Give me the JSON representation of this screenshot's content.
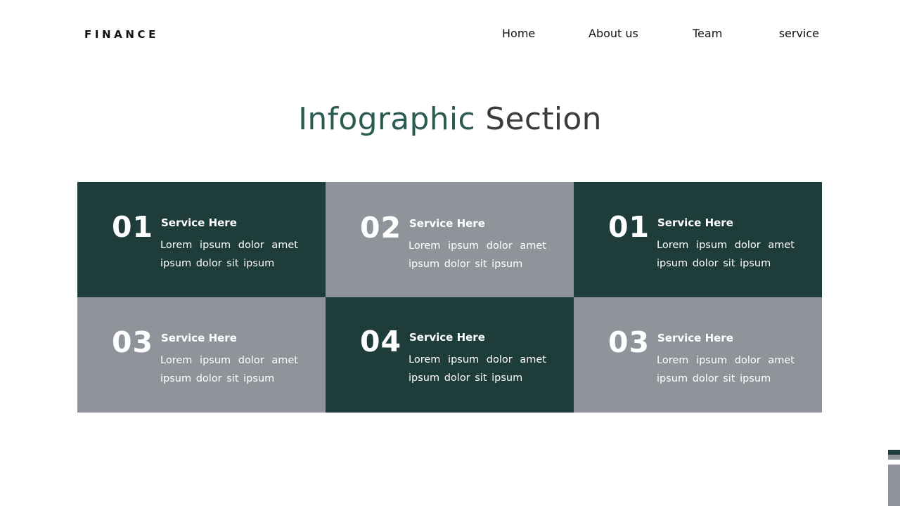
{
  "brand": {
    "name": "FINANCE"
  },
  "nav": {
    "items": [
      {
        "label": "Home"
      },
      {
        "label": "About us"
      },
      {
        "label": "Team"
      },
      {
        "label": "service"
      }
    ]
  },
  "section": {
    "title_accent": "Infographic",
    "title_rest": "Section"
  },
  "colors": {
    "dark_green": "#1e3d3a",
    "gray": "#8f949b",
    "accent_text": "#2a5c52"
  },
  "services": [
    {
      "number": "01",
      "title": "Service Here",
      "description": "Lorem ipsum dolor amet ipsum dolor sit ipsum"
    },
    {
      "number": "02",
      "title": "Service Here",
      "description": "Lorem ipsum dolor amet ipsum dolor sit ipsum"
    },
    {
      "number": "01",
      "title": "Service Here",
      "description": "Lorem ipsum dolor amet ipsum dolor sit ipsum"
    },
    {
      "number": "03",
      "title": "Service Here",
      "description": "Lorem ipsum dolor amet ipsum dolor sit ipsum"
    },
    {
      "number": "04",
      "title": "Service Here",
      "description": "Lorem ipsum dolor amet ipsum dolor sit ipsum"
    },
    {
      "number": "03",
      "title": "Service Here",
      "description": "Lorem ipsum dolor amet ipsum dolor sit ipsum"
    }
  ]
}
